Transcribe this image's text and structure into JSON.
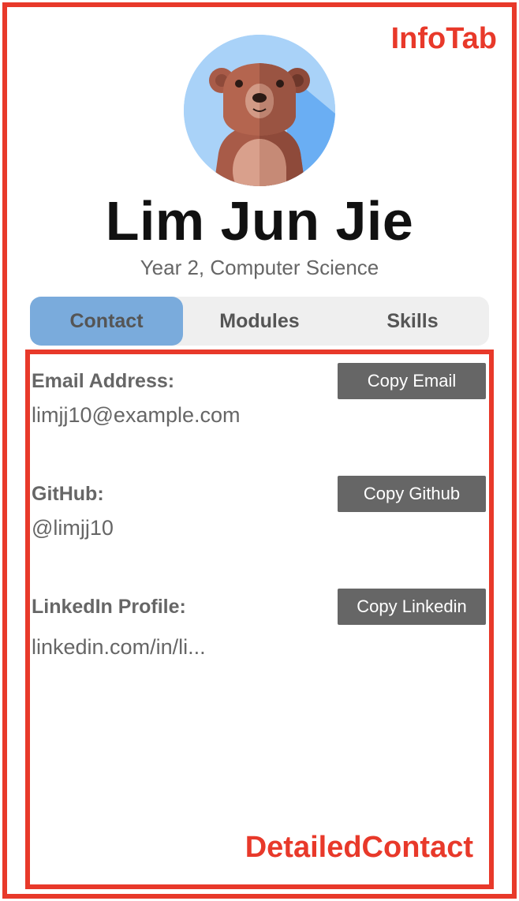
{
  "annotations": {
    "info_tab": "InfoTab",
    "detailed_contact": "DetailedContact"
  },
  "profile": {
    "name": "Lim Jun Jie",
    "subtitle": "Year 2, Computer Science",
    "avatar_icon": "bear-icon"
  },
  "tabs": [
    {
      "label": "Contact",
      "active": true
    },
    {
      "label": "Modules",
      "active": false
    },
    {
      "label": "Skills",
      "active": false
    }
  ],
  "contact": {
    "email": {
      "label": "Email Address:",
      "value": "limjj10@example.com",
      "button": "Copy Email"
    },
    "github": {
      "label": "GitHub:",
      "value": "@limjj10",
      "button": "Copy Github"
    },
    "linkedin": {
      "label": "LinkedIn Profile:",
      "value": "linkedin.com/in/li...",
      "button": "Copy Linkedin"
    }
  },
  "colors": {
    "annotation": "#e8392a",
    "active_tab": "#7aabdc",
    "tab_bar": "#efefef",
    "button": "#666666"
  }
}
